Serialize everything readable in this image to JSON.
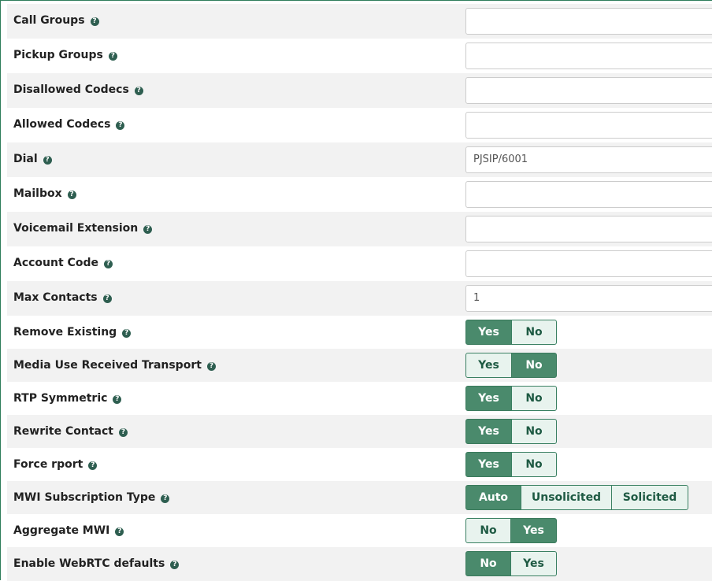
{
  "text_fields": [
    {
      "label": "Call Groups",
      "value": ""
    },
    {
      "label": "Pickup Groups",
      "value": ""
    },
    {
      "label": "Disallowed Codecs",
      "value": ""
    },
    {
      "label": "Allowed Codecs",
      "value": ""
    },
    {
      "label": "Dial",
      "value": "PJSIP/6001"
    },
    {
      "label": "Mailbox",
      "value": ""
    },
    {
      "label": "Voicemail Extension",
      "value": ""
    },
    {
      "label": "Account Code",
      "value": ""
    },
    {
      "label": "Max Contacts",
      "value": "1"
    }
  ],
  "toggle_fields": [
    {
      "label": "Remove Existing",
      "options": [
        "Yes",
        "No"
      ],
      "selected": "Yes"
    },
    {
      "label": "Media Use Received Transport",
      "options": [
        "Yes",
        "No"
      ],
      "selected": "No"
    },
    {
      "label": "RTP Symmetric",
      "options": [
        "Yes",
        "No"
      ],
      "selected": "Yes"
    },
    {
      "label": "Rewrite Contact",
      "options": [
        "Yes",
        "No"
      ],
      "selected": "Yes"
    },
    {
      "label": "Force rport",
      "options": [
        "Yes",
        "No"
      ],
      "selected": "Yes"
    },
    {
      "label": "MWI Subscription Type",
      "options": [
        "Auto",
        "Unsolicited",
        "Solicited"
      ],
      "selected": "Auto"
    },
    {
      "label": "Aggregate MWI",
      "options": [
        "No",
        "Yes"
      ],
      "selected": "Yes"
    },
    {
      "label": "Enable WebRTC defaults",
      "options": [
        "No",
        "Yes"
      ],
      "selected": "No"
    }
  ],
  "help_icon_glyph": "?",
  "colors": {
    "accent": "#4a8a6c",
    "accent_light": "#e8f3ee",
    "row_alt": "#f2f2f2",
    "help_icon": "#2e5e50"
  }
}
